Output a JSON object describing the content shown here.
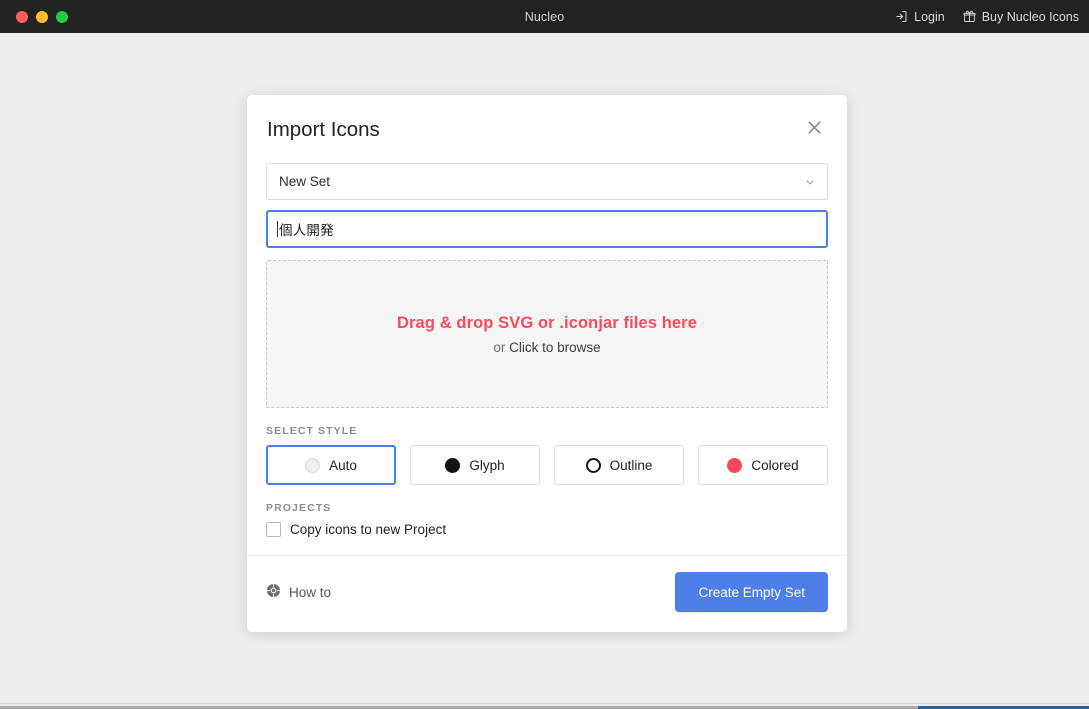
{
  "window": {
    "title": "Nucleo",
    "traffic_lights": [
      {
        "name": "close",
        "color": "#ff5f57"
      },
      {
        "name": "minimize",
        "color": "#ffbd2e"
      },
      {
        "name": "maximize",
        "color": "#28c840"
      }
    ],
    "actions": [
      {
        "icon": "login-icon",
        "label": "Login"
      },
      {
        "icon": "gift-icon",
        "label": "Buy Nucleo Icons"
      }
    ]
  },
  "modal": {
    "title": "Import Icons",
    "close_icon": "close-icon",
    "set_select": {
      "value": "New Set",
      "chevron_icon": "chevron-down-icon"
    },
    "name_input": {
      "value": "個人開発",
      "placeholder": "Set name",
      "focused": true
    },
    "dropzone": {
      "primary": "Drag & drop SVG or .iconjar files here",
      "or": "or",
      "browse": "Click to browse"
    },
    "style_section": {
      "label": "SELECT STYLE",
      "options": [
        {
          "label": "Auto",
          "swatch": "swatch-auto",
          "color": "#efefef",
          "selected": true
        },
        {
          "label": "Glyph",
          "swatch": "swatch-glyph",
          "color": "#141414",
          "selected": false
        },
        {
          "label": "Outline",
          "swatch": "swatch-outline",
          "color": "#141414",
          "selected": false
        },
        {
          "label": "Colored",
          "swatch": "swatch-colored",
          "color": "#f8495c",
          "selected": false
        }
      ]
    },
    "projects_section": {
      "label": "PROJECTS",
      "checkbox_label": "Copy icons to new Project",
      "checked": false
    },
    "footer": {
      "howto_icon": "help-compass-icon",
      "howto_label": "How to",
      "primary_label": "Create Empty Set"
    }
  },
  "colors": {
    "accent_blue": "#4e7fe8",
    "accent_red": "#fa4a5b",
    "titlebar": "#222222",
    "page_background": "#ededed",
    "scrollbar_thumb": "#2a6496"
  }
}
